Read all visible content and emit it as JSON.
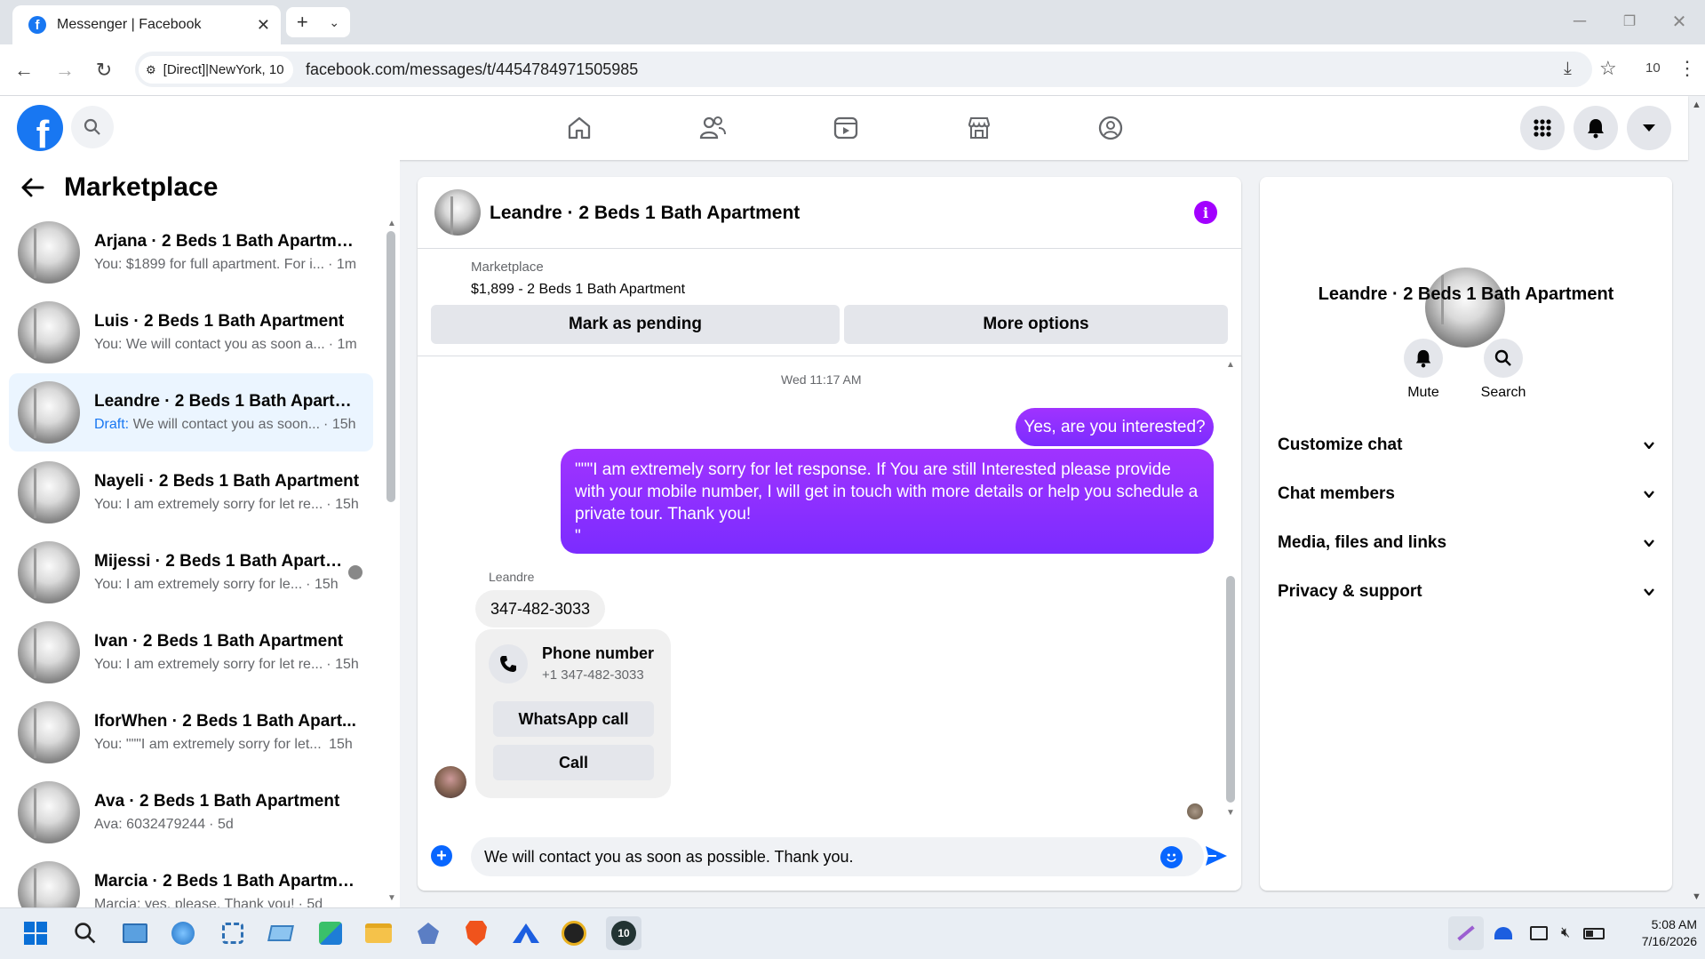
{
  "browser": {
    "tab_title": "Messenger | Facebook",
    "site_chip": "[Direct]|NewYork, 10",
    "url": "facebook.com/messages/t/4454784971505985",
    "profile_badge": "10"
  },
  "sidebar": {
    "title": "Marketplace",
    "conversations": [
      {
        "name": "Arjana · 2 Beds 1 Bath Apartment",
        "preview": "You: $1899 for full apartment. For i...",
        "time": "1m"
      },
      {
        "name": "Luis · 2 Beds 1 Bath Apartment",
        "preview": "You: We will contact you as soon a...",
        "time": "1m"
      },
      {
        "name": "Leandre · 2 Beds 1 Bath Apartme...",
        "draft_label": "Draft:",
        "preview": "We will contact you as soon...",
        "time": "15h",
        "active": true
      },
      {
        "name": "Nayeli · 2 Beds 1 Bath Apartment",
        "preview": "You: I am extremely sorry for let re...",
        "time": "15h"
      },
      {
        "name": "Mijessi · 2 Beds 1 Bath Apartm...",
        "preview": "You: I am extremely sorry for le...",
        "time": "15h"
      },
      {
        "name": "Ivan · 2 Beds 1 Bath Apartment",
        "preview": "You: I am extremely sorry for let re...",
        "time": "15h"
      },
      {
        "name": "IforWhen · 2 Beds 1 Bath Apart...",
        "preview": "You: \"\"\"I am extremely sorry for let...",
        "time": "15h"
      },
      {
        "name": "Ava · 2 Beds 1 Bath Apartment",
        "preview": "Ava: 6032479244",
        "time": "5d"
      },
      {
        "name": "Marcia · 2 Beds 1 Bath Apartment",
        "preview": "Marcia: yes, please. Thank you!",
        "time": "5d"
      }
    ]
  },
  "chat": {
    "header_title": "Leandre · 2 Beds 1 Bath Apartment",
    "listing_source": "Marketplace",
    "listing_title": "$1,899 - 2 Beds 1 Bath Apartment",
    "mark_pending": "Mark as pending",
    "more_options": "More options",
    "timestamp": "Wed 11:17 AM",
    "msg_out_1": "Yes, are you interested?",
    "msg_out_2": "\"\"\"I am extremely sorry for let response. If You are still Interested please provide with your mobile number, I will get in touch with more details or help you schedule a private tour. Thank you!\n\"",
    "sender_name": "Leandre",
    "msg_in_1": "347-482-3033",
    "phone_card_title": "Phone number",
    "phone_card_number": "+1 347-482-3033",
    "whatsapp_call": "WhatsApp call",
    "call": "Call",
    "composer_text": "We will contact you as soon as possible. Thank you."
  },
  "info": {
    "title": "Leandre · 2 Beds 1 Bath Apartment",
    "mute": "Mute",
    "search": "Search",
    "sections": [
      "Customize chat",
      "Chat members",
      "Media, files and links",
      "Privacy & support"
    ]
  },
  "taskbar": {
    "time": "5:08 AM",
    "date": "7/16/2026"
  },
  "colors": {
    "facebook_blue": "#1877f2",
    "message_purple": "#8b2cff",
    "info_icon": "#a200ff"
  }
}
